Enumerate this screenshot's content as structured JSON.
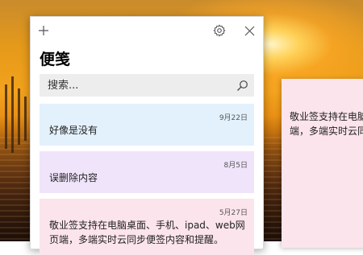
{
  "app": {
    "title": "便笺"
  },
  "toolbar": {
    "new_icon": "plus-icon",
    "settings_icon": "gear-icon",
    "close_icon": "close-icon"
  },
  "search": {
    "placeholder": "搜索...",
    "value": "",
    "icon": "search-icon"
  },
  "notes": [
    {
      "date": "9月22日",
      "text": "好像是没有",
      "color": "#e3f1fd"
    },
    {
      "date": "8月5日",
      "text": "误删除内容",
      "color": "#f0e4fb"
    },
    {
      "date": "5月27日",
      "text": "敬业签支持在电脑桌面、手机、ipad、web网页端，多端实时云同步便签内容和提醒。",
      "color": "#fce4ec"
    }
  ],
  "side_note": {
    "text": "敬业签支持在电脑\n端，多端实时云同",
    "color": "#fce4ec"
  }
}
